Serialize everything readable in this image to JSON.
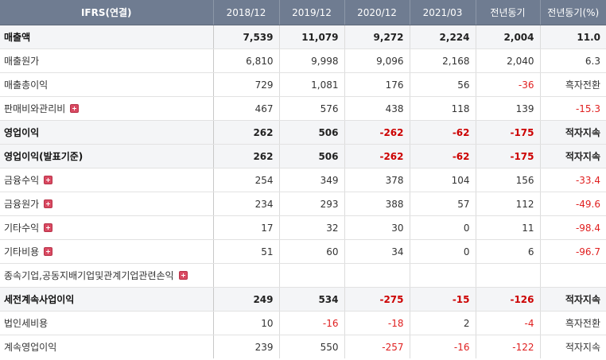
{
  "table": {
    "headers": [
      "IFRS(연결)",
      "2018/12",
      "2019/12",
      "2020/12",
      "2021/03",
      "전년동기",
      "전년동기(%)"
    ],
    "rows": [
      {
        "label": "매출액",
        "bold": true,
        "expand": false,
        "values": [
          "7,539",
          "11,079",
          "9,272",
          "2,224",
          "2,004",
          "11.0"
        ]
      },
      {
        "label": "매출원가",
        "bold": false,
        "expand": false,
        "values": [
          "6,810",
          "9,998",
          "9,096",
          "2,168",
          "2,040",
          "6.3"
        ]
      },
      {
        "label": "매출총이익",
        "bold": false,
        "expand": false,
        "values": [
          "729",
          "1,081",
          "176",
          "56",
          "-36",
          "흑자전환"
        ]
      },
      {
        "label": "판매비와관리비",
        "bold": false,
        "expand": true,
        "values": [
          "467",
          "576",
          "438",
          "118",
          "139",
          "-15.3"
        ]
      },
      {
        "label": "영업이익",
        "bold": true,
        "expand": false,
        "values": [
          "262",
          "506",
          "-262",
          "-62",
          "-175",
          "적자지속"
        ]
      },
      {
        "label": "영업이익(발표기준)",
        "bold": true,
        "expand": false,
        "values": [
          "262",
          "506",
          "-262",
          "-62",
          "-175",
          "적자지속"
        ]
      },
      {
        "label": "금융수익",
        "bold": false,
        "expand": true,
        "values": [
          "254",
          "349",
          "378",
          "104",
          "156",
          "-33.4"
        ]
      },
      {
        "label": "금융원가",
        "bold": false,
        "expand": true,
        "values": [
          "234",
          "293",
          "388",
          "57",
          "112",
          "-49.6"
        ]
      },
      {
        "label": "기타수익",
        "bold": false,
        "expand": true,
        "values": [
          "17",
          "32",
          "30",
          "0",
          "11",
          "-98.4"
        ]
      },
      {
        "label": "기타비용",
        "bold": false,
        "expand": true,
        "values": [
          "51",
          "60",
          "34",
          "0",
          "6",
          "-96.7"
        ]
      },
      {
        "label": "종속기업,공동지배기업및관계기업관련손익",
        "bold": false,
        "expand": true,
        "values": [
          "",
          "",
          "",
          "",
          "",
          ""
        ]
      },
      {
        "label": "세전계속사업이익",
        "bold": true,
        "expand": false,
        "values": [
          "249",
          "534",
          "-275",
          "-15",
          "-126",
          "적자지속"
        ]
      },
      {
        "label": "법인세비용",
        "bold": false,
        "expand": false,
        "values": [
          "10",
          "-16",
          "-18",
          "2",
          "-4",
          "흑자전환"
        ]
      },
      {
        "label": "계속영업이익",
        "bold": false,
        "expand": false,
        "values": [
          "239",
          "550",
          "-257",
          "-16",
          "-122",
          "적자지속"
        ]
      }
    ]
  },
  "colors": {
    "header_bg": "#6f7c91",
    "negative": "#e02020",
    "expand_icon": "#d94a62"
  },
  "icons": {
    "expand": "plus-square-icon"
  }
}
